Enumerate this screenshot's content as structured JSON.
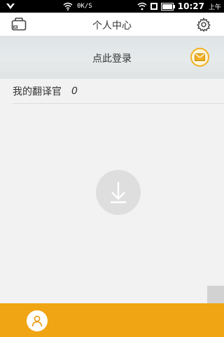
{
  "status_bar": {
    "net_speed": "0K/S",
    "time": "10:27",
    "am_pm": "上午",
    "icons": [
      "app-notification-icon",
      "wifi-icon",
      "sim-icon",
      "battery-icon"
    ]
  },
  "header": {
    "title": "个人中心",
    "left_icon": "wallet-icon",
    "right_icon": "settings-gear-icon"
  },
  "banner": {
    "login_prompt": "点此登录",
    "message_icon": "mail-icon",
    "accent_color": "#f0b023"
  },
  "translator": {
    "label": "我的翻译官",
    "count": "0"
  },
  "main": {
    "center_icon": "download-icon"
  },
  "footer": {
    "background_color": "#f0a514",
    "icon": "user-avatar-icon"
  }
}
